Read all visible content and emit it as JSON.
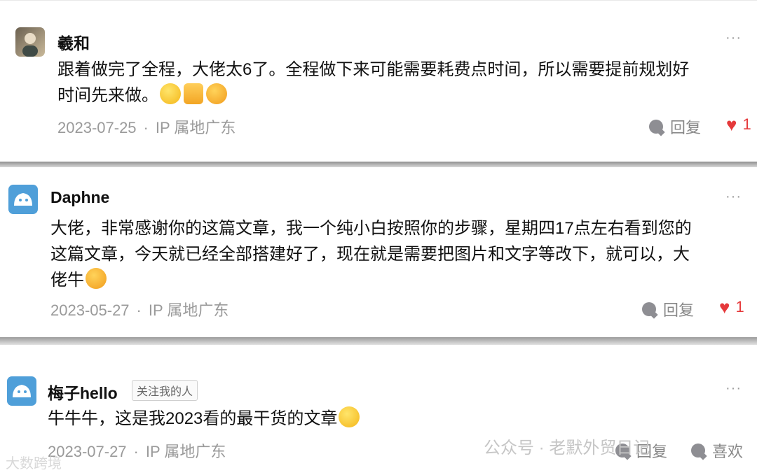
{
  "comments": [
    {
      "name": "羲和",
      "text_line1": "跟着做完了全程，大佬太6了。全程做下来可能需要耗费点时间，所以需要提前规划好",
      "text_line2": "时间先来做。",
      "date": "2023-07-25",
      "sep": "·",
      "ip": "IP 属地广东",
      "reply_label": "回复",
      "like_count": "1",
      "avatar_icon": "person-avatar-icon",
      "emojis": [
        "praise-emoji",
        "pray-hands-emoji",
        "blush-emoji"
      ]
    },
    {
      "name": "Daphne",
      "text_line1": "大佬，非常感谢你的这篇文章，我一个纯小白按照你的步骤，星期四17点左右看到您的",
      "text_line2": "这篇文章，今天就已经全部搭建好了，现在就是需要把图片和文字等改下，就可以，大",
      "text_line3": "佬牛",
      "date": "2023-05-27",
      "sep": "·",
      "ip": "IP 属地广东",
      "reply_label": "回复",
      "like_count": "1",
      "avatar_icon": "default-avatar-icon",
      "emojis": [
        "kiss-emoji"
      ]
    },
    {
      "name": "梅子hello",
      "tag": "关注我的人",
      "text_line1": "牛牛牛，这是我2023看的最干货的文章",
      "date": "2023-07-27",
      "sep": "·",
      "ip": "IP 属地广东",
      "reply_label": "回复",
      "like_label": "喜欢",
      "avatar_icon": "default-avatar-icon",
      "emojis": [
        "grin-emoji"
      ]
    }
  ],
  "more_label": "···",
  "watermark": {
    "right": "公众号 · 老默外贸日记",
    "left": "大数跨境"
  },
  "colors": {
    "accent_heart": "#e5393b",
    "meta_text": "#9a9a9a"
  }
}
